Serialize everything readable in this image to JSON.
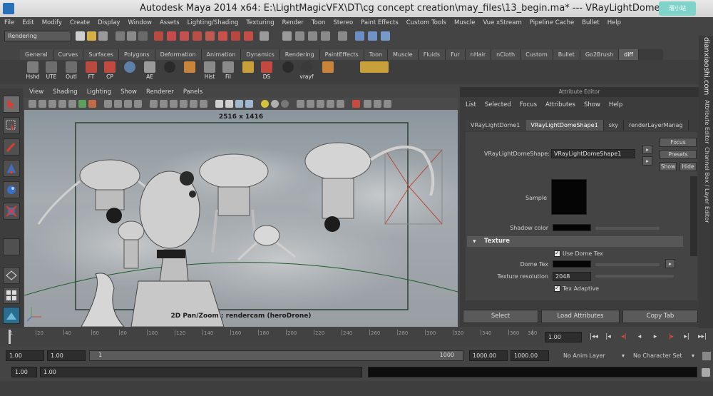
{
  "window": {
    "title": "Autodesk Maya 2014 x64: E:\\LightMagicVFX\\DT\\cg concept creation\\may_files\\13_begin.ma*   ---   VRayLightDome1",
    "corner_logo": "溜小站"
  },
  "menubar": [
    "File",
    "Edit",
    "Modify",
    "Create",
    "Display",
    "Window",
    "Assets",
    "Lighting/Shading",
    "Texturing",
    "Render",
    "Toon",
    "Stereo",
    "Paint Effects",
    "Custom Tools",
    "Muscle",
    "Vue xStream",
    "Pipeline Cache",
    "Bullet",
    "Help"
  ],
  "status": {
    "mode": "Rendering"
  },
  "shelf": {
    "tabs": [
      "General",
      "Curves",
      "Surfaces",
      "Polygons",
      "Deformation",
      "Animation",
      "Dynamics",
      "Rendering",
      "PaintEffects",
      "Toon",
      "Muscle",
      "Fluids",
      "Fur",
      "nHair",
      "nCloth",
      "Custom",
      "Bullet",
      "Go2Brush",
      "diff"
    ],
    "active_tab": "diff",
    "buttons": [
      "Hshd",
      "UTE",
      "Outl",
      "FT",
      "CP",
      "",
      "AE",
      "",
      "",
      "Hist",
      "Fil",
      "",
      "DS",
      "",
      "vrayf",
      "",
      ""
    ]
  },
  "viewport": {
    "menu": [
      "View",
      "Shading",
      "Lighting",
      "Show",
      "Renderer",
      "Panels"
    ],
    "resolution_label": "2516 x 1416",
    "hud_label": "2D Pan/Zoom : rendercam (heroDrone)"
  },
  "attribute_editor": {
    "header": "Attribute Editor",
    "menu": [
      "List",
      "Selected",
      "Focus",
      "Attributes",
      "Show",
      "Help"
    ],
    "tabs": [
      "VRayLightDome1",
      "VRayLightDomeShape1",
      "sky",
      "renderLayerManag"
    ],
    "active_tab": "VRayLightDomeShape1",
    "node_label": "VRayLightDomeShape:",
    "node_value": "VRayLightDomeShape1",
    "focus_btn": "Focus",
    "presets_btn": "Presets",
    "show_btn": "Show",
    "hide_btn": "Hide",
    "sample_label": "Sample",
    "shadow_color_label": "Shadow color",
    "texture_section": "Texture",
    "use_dome_tex": "Use Dome Tex",
    "dome_tex_label": "Dome Tex",
    "texture_resolution_label": "Texture resolution",
    "texture_resolution_value": "2048",
    "tex_adaptive": "Tex Adaptive",
    "bottom_buttons": [
      "Select",
      "Load Attributes",
      "Copy Tab"
    ]
  },
  "side_strip": {
    "watermark": "dianxiaoshi.com",
    "label": "Channel Box / Layer Editor",
    "ae_label": "Attribute Editor"
  },
  "timeline": {
    "ticks": [
      "1",
      "20",
      "40",
      "60",
      "80",
      "100",
      "120",
      "140",
      "160",
      "180",
      "200",
      "220",
      "240",
      "260",
      "280",
      "300",
      "320",
      "340",
      "360",
      "380"
    ],
    "current_time": "1.00",
    "playback": [
      "|◂◂",
      "|◂",
      "◂|",
      "◂",
      "▸",
      "|▸",
      "▸|",
      "▸▸|"
    ]
  },
  "range": {
    "start": "1.00",
    "playback_start": "1.00",
    "range_start_label": "1",
    "range_end_label": "1000",
    "playback_end": "1000.00",
    "end": "1000.00",
    "anim_layer": "No Anim Layer",
    "character_set": "No Character Set"
  },
  "command_line": {
    "field1": "1.00",
    "field2": "1.00"
  },
  "colors": {
    "accent_red": "#c83a2e",
    "selected_blue": "#4a6ea0",
    "panel": "#444444"
  }
}
